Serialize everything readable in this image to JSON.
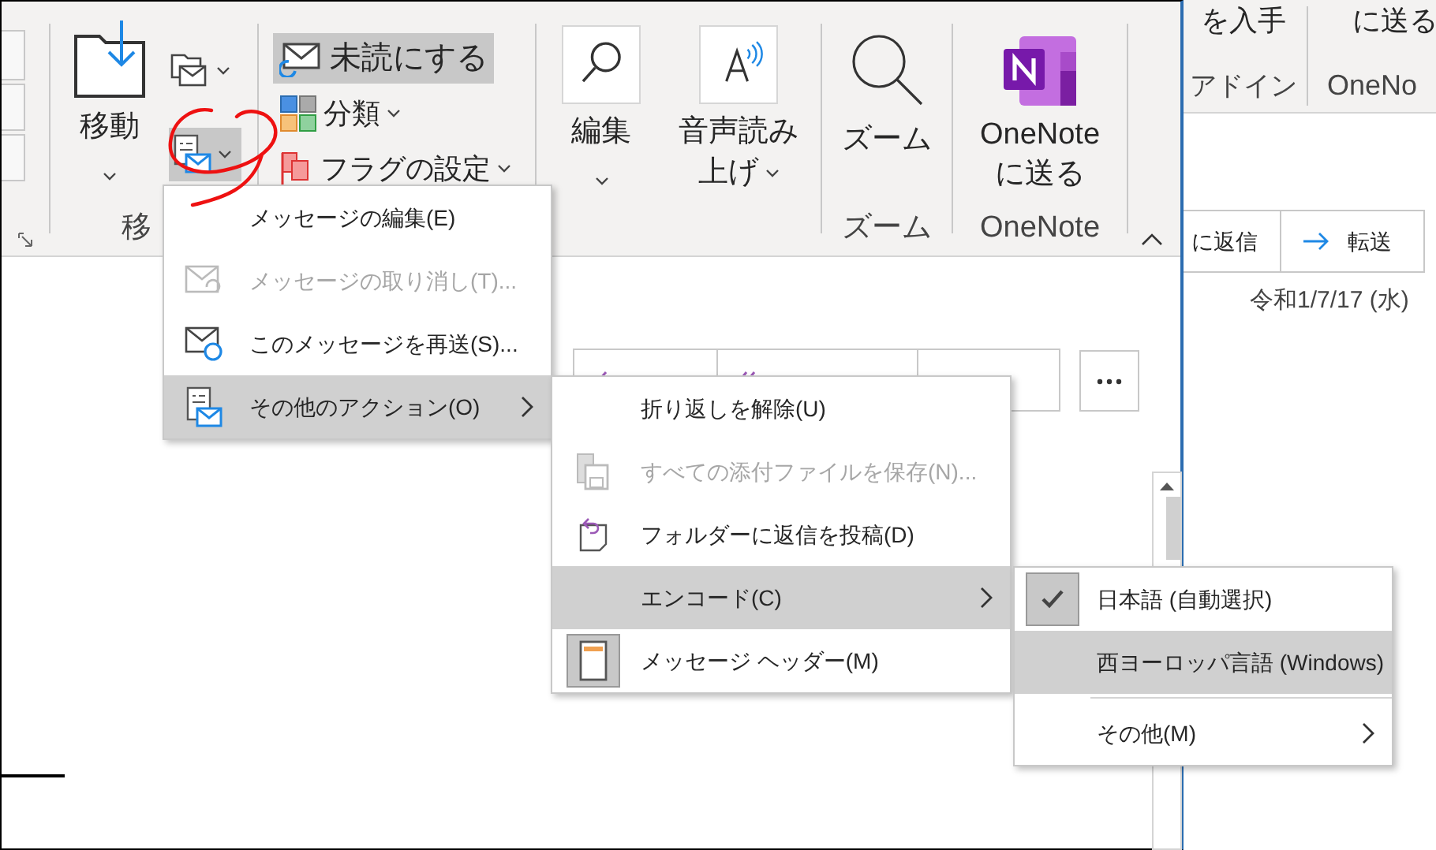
{
  "ribbon": {
    "move_group": {
      "move_button": "移動",
      "label": "移"
    },
    "tags_group": [
      {
        "label": "未読にする",
        "selected": true
      },
      {
        "label": "分類",
        "selected": false
      },
      {
        "label": "フラグの設定",
        "selected": false
      }
    ],
    "edit_button": "編集",
    "read_aloud_button": [
      "音声読み",
      "上げ"
    ],
    "zoom_group": {
      "button": "ズーム",
      "label": "ズーム"
    },
    "onenote_group": {
      "button": [
        "OneNote",
        "に送る"
      ],
      "label": "OneNote"
    }
  },
  "background_window": {
    "ribbon_buttons": [
      "を入手",
      "に送る"
    ],
    "group_labels": [
      "アドイン",
      "OneNo"
    ],
    "buttons": [
      "に返信",
      "転送"
    ],
    "date": "令和1/7/17 (水)"
  },
  "menus": [
    {
      "items": [
        {
          "kind": "command",
          "label": "メッセージの編集(E)",
          "disabled": false,
          "selected": false
        },
        {
          "kind": "command",
          "label": "メッセージの取り消し(T)...",
          "disabled": true,
          "selected": false
        },
        {
          "kind": "command",
          "label": "このメッセージを再送(S)...",
          "disabled": false,
          "selected": false
        },
        {
          "kind": "submenu",
          "label": "その他のアクション(O)",
          "disabled": false,
          "selected": true
        }
      ]
    },
    {
      "items": [
        {
          "kind": "command",
          "label": "折り返しを解除(U)",
          "disabled": false,
          "selected": false,
          "checked": false
        },
        {
          "kind": "command",
          "label": "すべての添付ファイルを保存(N)...",
          "disabled": true,
          "selected": false,
          "checked": false
        },
        {
          "kind": "command",
          "label": "フォルダーに返信を投稿(D)",
          "disabled": false,
          "selected": false,
          "checked": false
        },
        {
          "kind": "submenu",
          "label": "エンコード(C)",
          "disabled": false,
          "selected": true,
          "checked": false
        },
        {
          "kind": "command",
          "label": "メッセージ ヘッダー(M)",
          "disabled": false,
          "selected": false,
          "checked": true
        }
      ]
    },
    {
      "items": [
        {
          "kind": "command",
          "label": "日本語 (自動選択)",
          "disabled": false,
          "selected": false,
          "checked": true
        },
        {
          "kind": "command",
          "label": "西ヨーロッパ言語 (Windows)",
          "disabled": false,
          "selected": true,
          "checked": false
        },
        {
          "kind": "separator"
        },
        {
          "kind": "submenu",
          "label": "その他(M)",
          "disabled": false,
          "selected": false,
          "checked": false
        }
      ]
    }
  ]
}
